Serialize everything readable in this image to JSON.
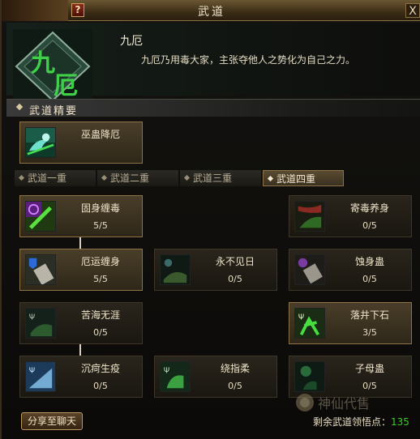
{
  "window": {
    "title": "武道",
    "help_label": "?",
    "close_label": "X"
  },
  "header": {
    "emblem_text": "九厄",
    "name": "九厄",
    "description": "九厄乃用毒大家，主张夺他人之势化为自己之力。"
  },
  "section": {
    "title": "武道精要"
  },
  "main_skill": {
    "name": "巫蛊降厄",
    "icon": "skill-icon-cyan-bird"
  },
  "tabs": [
    {
      "label": "武道一重",
      "active": false
    },
    {
      "label": "武道二重",
      "active": false
    },
    {
      "label": "武道三重",
      "active": false
    },
    {
      "label": "武道四重",
      "active": true
    }
  ],
  "skills": [
    {
      "name": "固身缠毒",
      "level": "5/5",
      "lit": true,
      "icon": "purple-green-icon"
    },
    {
      "name": "寄毒养身",
      "level": "0/5",
      "lit": false,
      "icon": "red-green-icon"
    },
    {
      "name": "厄运缠身",
      "level": "5/5",
      "lit": true,
      "icon": "blue-shield-icon"
    },
    {
      "name": "永不见日",
      "level": "0/5",
      "lit": false,
      "icon": "dark-moon-icon"
    },
    {
      "name": "蚀身蛊",
      "level": "0/5",
      "lit": false,
      "icon": "purple-fist-icon"
    },
    {
      "name": "苦海无涯",
      "level": "0/5",
      "lit": false,
      "icon": "green-fist-icon"
    },
    {
      "name": "落井下石",
      "level": "3/5",
      "lit": true,
      "icon": "green-claw-icon"
    },
    {
      "name": "沉疴生疫",
      "level": "0/5",
      "lit": false,
      "icon": "blue-wave-icon"
    },
    {
      "name": "绕指柔",
      "level": "0/5",
      "lit": false,
      "icon": "green-hand-icon"
    },
    {
      "name": "子母蛊",
      "level": "0/5",
      "lit": false,
      "icon": "green-orb-icon"
    }
  ],
  "footer": {
    "share_label": "分享至聊天",
    "remain_label": "剩余武道领悟点：",
    "remain_count": "135"
  },
  "watermark": "神仙代售",
  "colors": {
    "accent_gold": "#8c7448",
    "count_green": "#34d024"
  }
}
